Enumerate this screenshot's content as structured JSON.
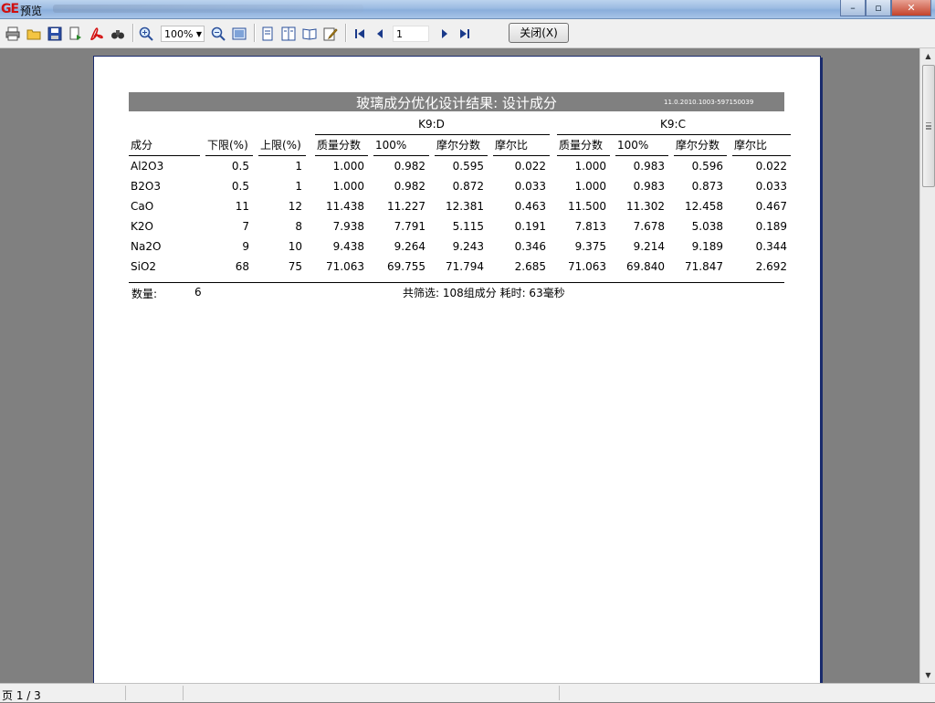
{
  "window": {
    "logo": "GE",
    "title": "预览",
    "minimize": "–",
    "maximize": "▫",
    "close": "✕"
  },
  "toolbar": {
    "zoom_value": "100%",
    "page_value": "1",
    "close_label": "关闭(X)",
    "icons": [
      "print-icon",
      "open-folder-icon",
      "save-icon",
      "export-icon",
      "pdf-icon",
      "find-icon",
      "zoom-in-icon",
      "zoom-out-icon",
      "fit-page-icon",
      "single-page-icon",
      "two-page-icon",
      "book-icon",
      "edit-icon",
      "first-page-icon",
      "prev-page-icon",
      "next-page-icon",
      "last-page-icon"
    ]
  },
  "report": {
    "title": "玻璃成分优化设计结果: 设计成分",
    "id_text": "11.0.2010.1003-597150039",
    "groups": [
      "K9:D",
      "K9:C"
    ],
    "headers": [
      "成分",
      "下限(%)",
      "上限(%)",
      "质量分数",
      "100%",
      "摩尔分数",
      "摩尔比",
      "质量分数",
      "100%",
      "摩尔分数",
      "摩尔比"
    ],
    "rows": [
      [
        "Al2O3",
        "0.5",
        "1",
        "1.000",
        "0.982",
        "0.595",
        "0.022",
        "1.000",
        "0.983",
        "0.596",
        "0.022"
      ],
      [
        "B2O3",
        "0.5",
        "1",
        "1.000",
        "0.982",
        "0.872",
        "0.033",
        "1.000",
        "0.983",
        "0.873",
        "0.033"
      ],
      [
        "CaO",
        "11",
        "12",
        "11.438",
        "11.227",
        "12.381",
        "0.463",
        "11.500",
        "11.302",
        "12.458",
        "0.467"
      ],
      [
        "K2O",
        "7",
        "8",
        "7.938",
        "7.791",
        "5.115",
        "0.191",
        "7.813",
        "7.678",
        "5.038",
        "0.189"
      ],
      [
        "Na2O",
        "9",
        "10",
        "9.438",
        "9.264",
        "9.243",
        "0.346",
        "9.375",
        "9.214",
        "9.189",
        "0.344"
      ],
      [
        "SiO2",
        "68",
        "75",
        "71.063",
        "69.755",
        "71.794",
        "2.685",
        "71.063",
        "69.840",
        "71.847",
        "2.692"
      ]
    ],
    "count_label": "数量:",
    "count_value": "6",
    "summary": "共筛选: 108组成分 耗时: 63毫秒"
  },
  "status": {
    "page_info": "页 1 / 3"
  }
}
